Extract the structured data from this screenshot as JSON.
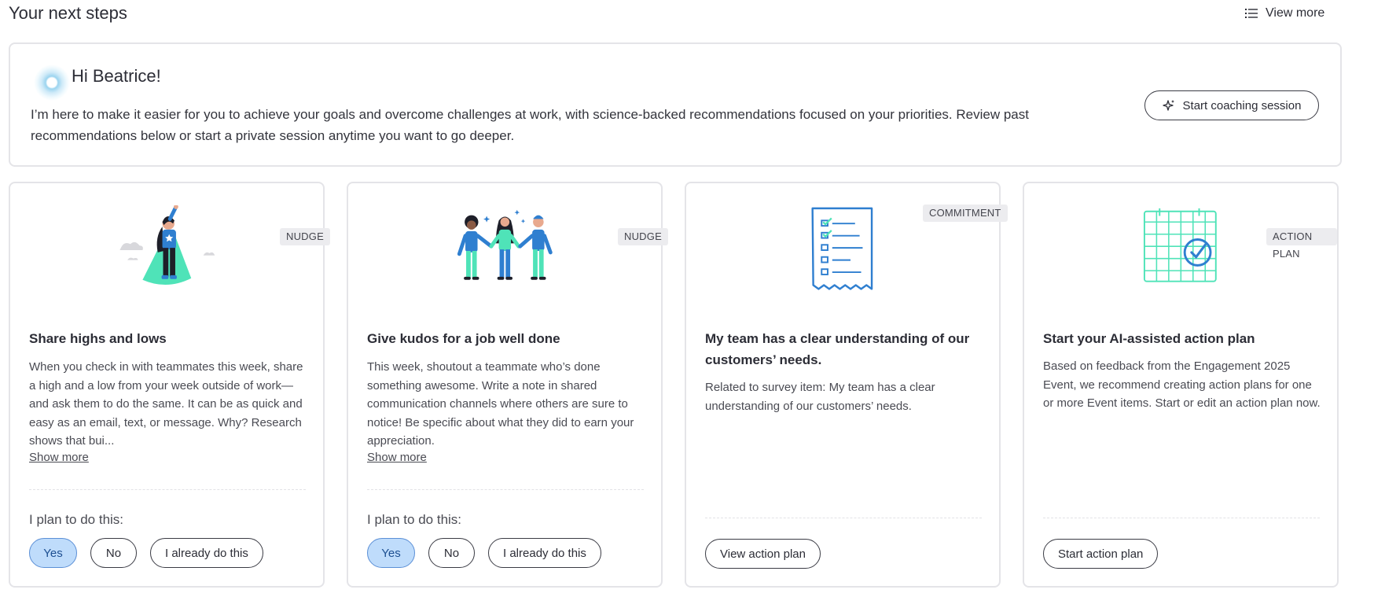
{
  "header": {
    "title": "Your next steps",
    "view_more": "View more"
  },
  "coach": {
    "greeting": "Hi Beatrice!",
    "message": "I’m here to make it easier for you to achieve your goals and overcome challenges at work, with science-backed recommendations focused on your priorities. Review past recommendations below or start a private session anytime you want to go deeper.",
    "button": "Start coaching session"
  },
  "cards": [
    {
      "badge": "NUDGE",
      "title": "Share highs and lows",
      "body": "When you check in with teammates this week, share a high and a low from your week outside of work—and ask them to do the same. It can be as quick and easy as an email, text, or message. Why? Research shows that bui...",
      "show_more": "Show more",
      "plan_label": "I plan to do this:",
      "choices": [
        "Yes",
        "No",
        "I already do this"
      ],
      "selected": "Yes"
    },
    {
      "badge": "NUDGE",
      "title": "Give kudos for a job well done",
      "body": "This week, shoutout a teammate who’s done something awesome. Write a note in shared communication channels where others are sure to notice! Be specific about what they did to earn your appreciation.",
      "show_more": "Show more",
      "plan_label": "I plan to do this:",
      "choices": [
        "Yes",
        "No",
        "I already do this"
      ],
      "selected": "Yes"
    },
    {
      "badge": "COMMITMENT",
      "title": "My team has a clear understanding of our customers’ needs.",
      "body": "Related to survey item: My team has a clear understanding of our customers’ needs.",
      "action": "View action plan"
    },
    {
      "badge": "ACTION PLAN",
      "title": "Start your AI-assisted action plan",
      "body": "Based on feedback from the Engagement 2025 Event, we recommend creating action plans for one or more Event items. Start or edit an action plan now.",
      "action": "Start action plan"
    }
  ],
  "colors": {
    "accent_teal": "#4fe3b8",
    "accent_blue": "#2f7fd0",
    "selected_fill": "#bfdcfb"
  },
  "icons": {
    "view_more": "list-icon",
    "coach_button": "sparkle-icon",
    "coach_avatar": "glowing-orb-icon"
  }
}
